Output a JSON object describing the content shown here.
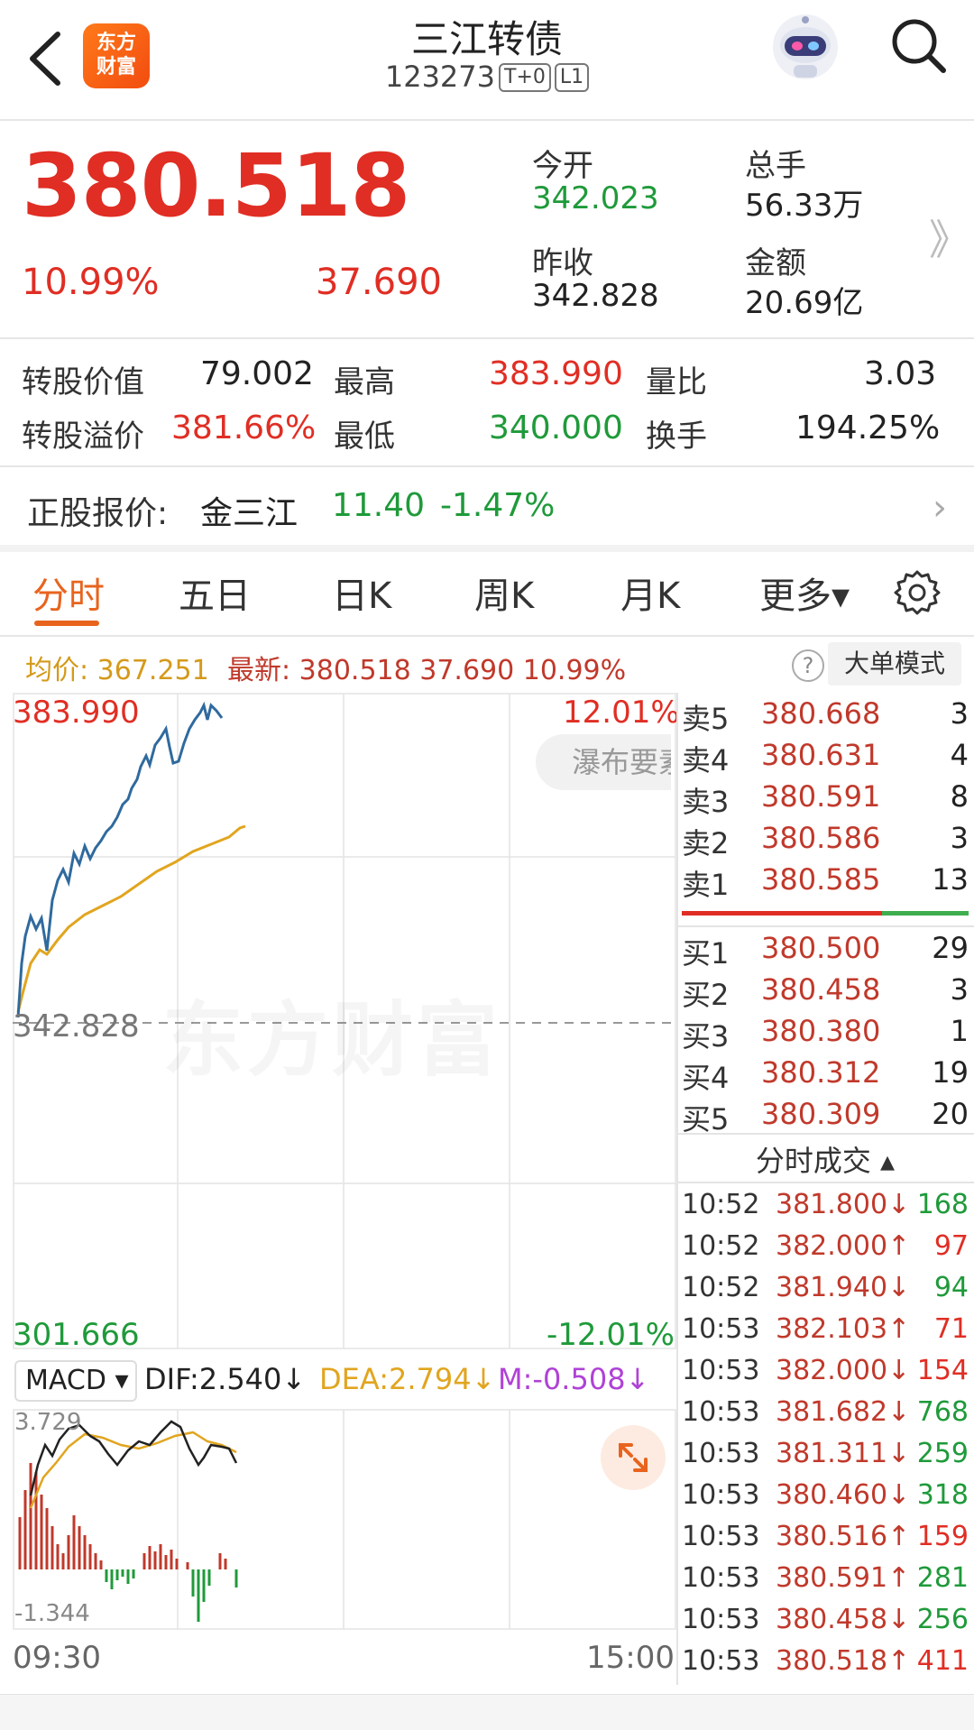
{
  "header": {
    "title": "三江转债",
    "code": "123273",
    "tags": [
      "T+0",
      "L1"
    ],
    "logo_text": [
      "东方",
      "财富"
    ]
  },
  "quote": {
    "price": "380.518",
    "change_pct": "10.99%",
    "change_val": "37.690",
    "open_label": "今开",
    "open": "342.023",
    "volume_label": "总手",
    "volume": "56.33万",
    "prev_close_label": "昨收",
    "prev_close": "342.828",
    "amount_label": "金额",
    "amount": "20.69亿",
    "more": "》"
  },
  "details": {
    "conv_value_label": "转股价值",
    "conv_value": "79.002",
    "high_label": "最高",
    "high": "383.990",
    "vol_ratio_label": "量比",
    "vol_ratio": "3.03",
    "premium_label": "转股溢价",
    "premium": "381.66%",
    "low_label": "最低",
    "low": "340.000",
    "turnover_label": "换手",
    "turnover": "194.25%"
  },
  "stock": {
    "label": "正股报价:",
    "name": "金三江",
    "price": "11.40",
    "pct": "-1.47%",
    "chevron": "›"
  },
  "tabs": [
    {
      "label": "分时"
    },
    {
      "label": "五日"
    },
    {
      "label": "日K"
    },
    {
      "label": "周K"
    },
    {
      "label": "月K"
    },
    {
      "label": "更多▾"
    }
  ],
  "infobar": {
    "avg": "均价: 367.251",
    "latest": "最新: 380.518 37.690 10.99%",
    "help": "?",
    "big_mode": "大单模式"
  },
  "chart_labels": {
    "top_price": "383.990",
    "top_pct": "12.01%",
    "mid_price": "342.828",
    "bottom_price": "301.666",
    "bottom_pct": "-12.01%",
    "pill": "瀑布要素",
    "watermark": "东方财富"
  },
  "macd": {
    "selector": "MACD ▾",
    "dif": "DIF:2.540↓",
    "dea": "DEA:2.794↓",
    "m": "M:-0.508↓",
    "top_val": "3.729",
    "bottom_val": "-1.344",
    "time_start": "09:30",
    "time_end": "15:00"
  },
  "order_book": {
    "asks": [
      {
        "label": "卖5",
        "price": "380.668",
        "vol": "3"
      },
      {
        "label": "卖4",
        "price": "380.631",
        "vol": "4"
      },
      {
        "label": "卖3",
        "price": "380.591",
        "vol": "8"
      },
      {
        "label": "卖2",
        "price": "380.586",
        "vol": "3"
      },
      {
        "label": "卖1",
        "price": "380.585",
        "vol": "13"
      }
    ],
    "bids": [
      {
        "label": "买1",
        "price": "380.500",
        "vol": "29"
      },
      {
        "label": "买2",
        "price": "380.458",
        "vol": "3"
      },
      {
        "label": "买3",
        "price": "380.380",
        "vol": "1"
      },
      {
        "label": "买4",
        "price": "380.312",
        "vol": "19"
      },
      {
        "label": "买5",
        "price": "380.309",
        "vol": "20"
      }
    ]
  },
  "ticks": {
    "title": "分时成交 ▴",
    "rows": [
      {
        "time": "10:52",
        "price": "381.800↓",
        "vol": "168",
        "dir": "down"
      },
      {
        "time": "10:52",
        "price": "382.000↑",
        "vol": "97",
        "dir": "up"
      },
      {
        "time": "10:52",
        "price": "381.940↓",
        "vol": "94",
        "dir": "down"
      },
      {
        "time": "10:53",
        "price": "382.103↑",
        "vol": "71",
        "dir": "up"
      },
      {
        "time": "10:53",
        "price": "382.000↓",
        "vol": "154",
        "dir": "up"
      },
      {
        "time": "10:53",
        "price": "381.682↓",
        "vol": "768",
        "dir": "down"
      },
      {
        "time": "10:53",
        "price": "381.311↓",
        "vol": "259",
        "dir": "down"
      },
      {
        "time": "10:53",
        "price": "380.460↓",
        "vol": "318",
        "dir": "down"
      },
      {
        "time": "10:53",
        "price": "380.516↑",
        "vol": "159",
        "dir": "up"
      },
      {
        "time": "10:53",
        "price": "380.591↑",
        "vol": "281",
        "dir": "down"
      },
      {
        "time": "10:53",
        "price": "380.458↓",
        "vol": "256",
        "dir": "down"
      },
      {
        "time": "10:53",
        "price": "380.518↑",
        "vol": "411",
        "dir": "up"
      }
    ]
  },
  "colors": {
    "red": "#e02e24",
    "green": "#1f9a3a",
    "accent": "#e8641e",
    "price_line": "#2f6a9e",
    "avg_line": "#e1a51f"
  }
}
